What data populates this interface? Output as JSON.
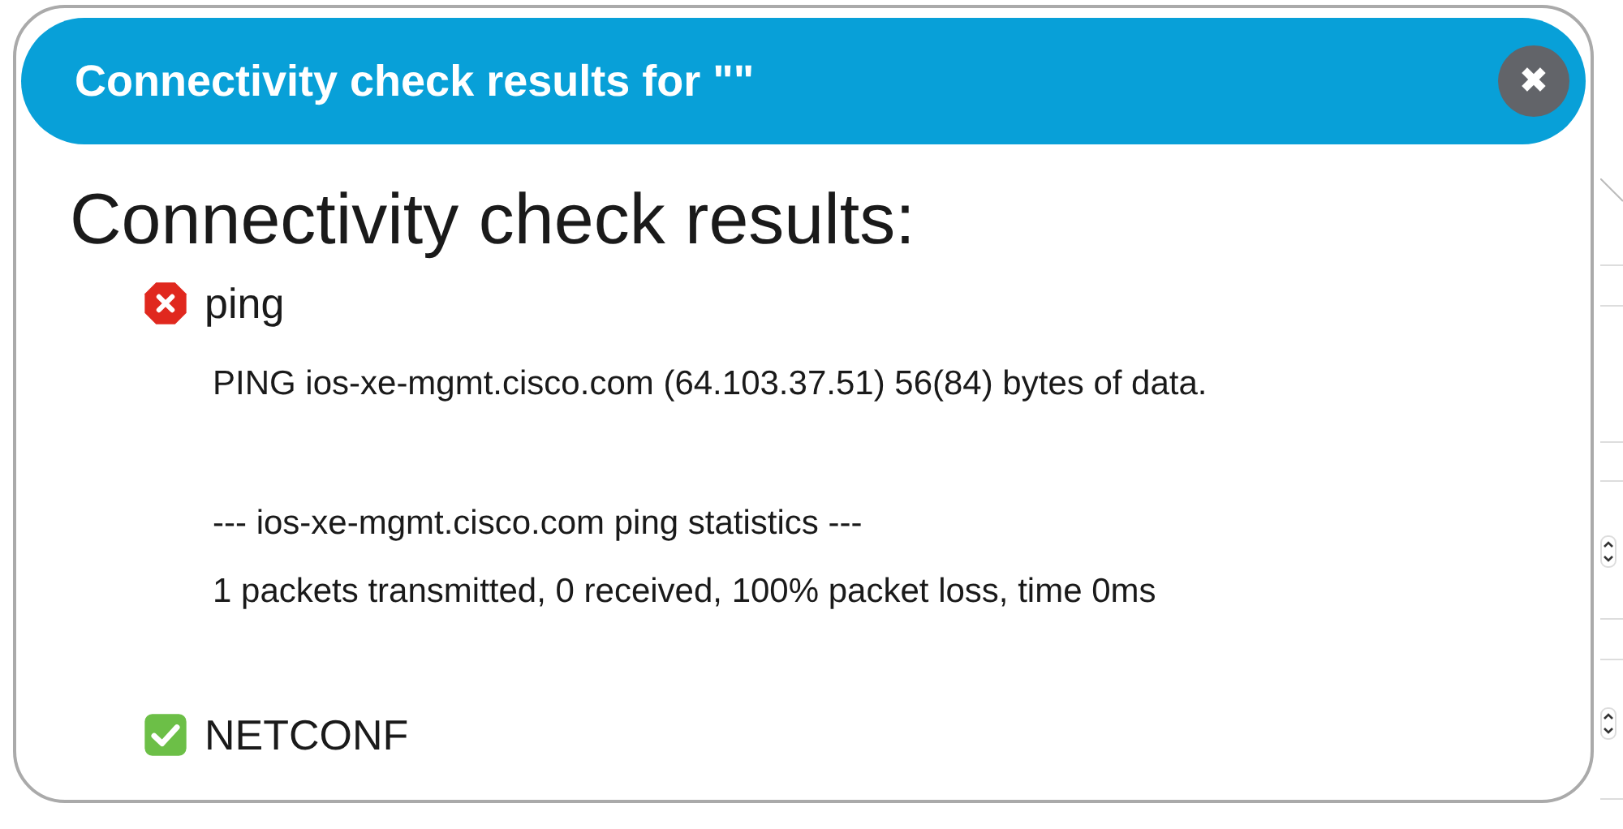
{
  "dialog": {
    "title": "Connectivity check results for \"\"",
    "close_label": "✖"
  },
  "heading": "Connectivity check results:",
  "checks": [
    {
      "kind": "fail",
      "name": "ping",
      "output_blocks": [
        [
          "PING ios-xe-mgmt.cisco.com (64.103.37.51) 56(84) bytes of data."
        ],
        [
          "--- ios-xe-mgmt.cisco.com ping statistics ---",
          "1 packets transmitted, 0 received, 100% packet loss, time 0ms"
        ]
      ]
    },
    {
      "kind": "pass",
      "name": "NETCONF"
    }
  ]
}
